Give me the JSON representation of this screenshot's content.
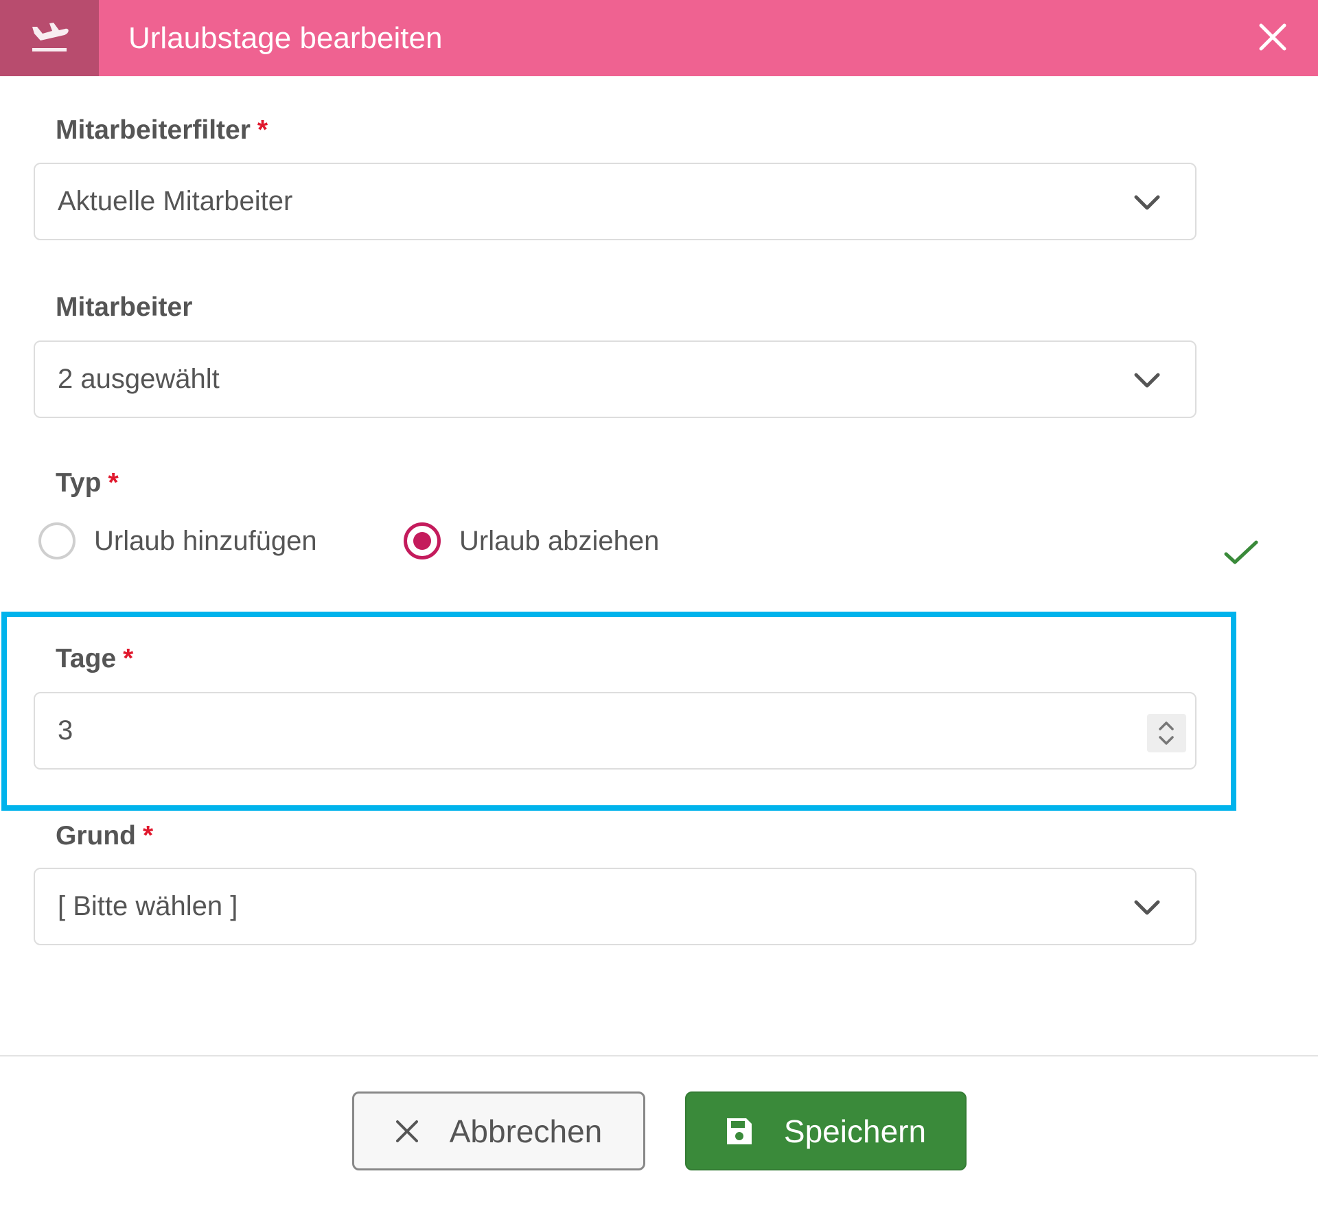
{
  "header": {
    "title": "Urlaubstage bearbeiten",
    "icon": "flight-takeoff-icon",
    "background_color": "#ef6291",
    "icon_box_color": "#b84c6e"
  },
  "form": {
    "employee_filter": {
      "label": "Mitarbeiterfilter",
      "required_marker": "*",
      "value": "Aktuelle Mitarbeiter"
    },
    "employees": {
      "label": "Mitarbeiter",
      "value": "2 ausgewählt"
    },
    "type": {
      "label": "Typ",
      "required_marker": "*",
      "options": [
        {
          "label": "Urlaub hinzufügen",
          "checked": false
        },
        {
          "label": "Urlaub abziehen",
          "checked": true
        }
      ],
      "selected_color": "#c41b5c"
    },
    "days": {
      "label": "Tage",
      "required_marker": "*",
      "value": "3"
    },
    "reason": {
      "label": "Grund",
      "required_marker": "*",
      "value": "[ Bitte wählen ]"
    }
  },
  "buttons": {
    "cancel_label": "Abbrechen",
    "save_label": "Speichern",
    "save_color": "#3a8a3a"
  },
  "highlight_color": "#00b3ec"
}
